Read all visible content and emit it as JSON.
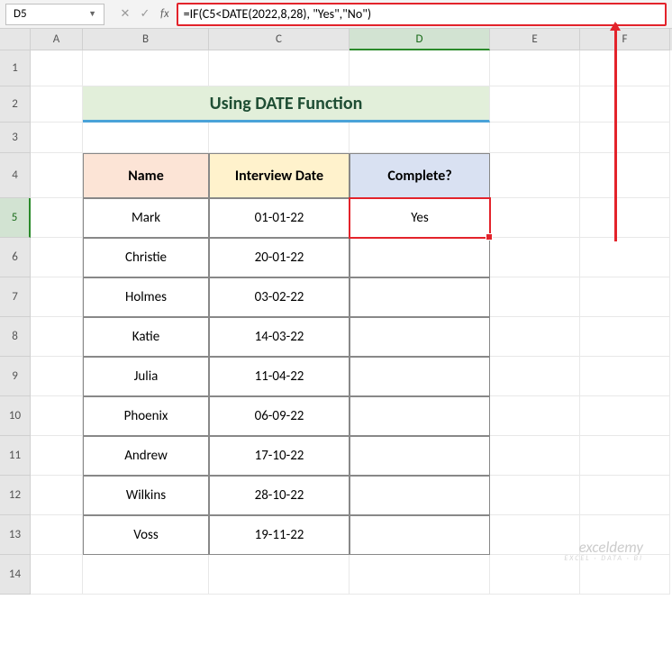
{
  "nameBox": "D5",
  "formula": "=IF(C5<DATE(2022,8,28), \"Yes\",\"No\")",
  "colHeaders": [
    "A",
    "B",
    "C",
    "D",
    "E",
    "F"
  ],
  "rowHeaders": [
    1,
    2,
    3,
    4,
    5,
    6,
    7,
    8,
    9,
    10,
    11,
    12,
    13,
    14
  ],
  "selectedCol": "D",
  "selectedRow": 5,
  "title": "Using DATE Function",
  "tableHeaders": {
    "name": "Name",
    "date": "Interview Date",
    "complete": "Complete?"
  },
  "rows": [
    {
      "name": "Mark",
      "date": "01-01-22",
      "complete": "Yes"
    },
    {
      "name": "Christie",
      "date": "20-01-22",
      "complete": ""
    },
    {
      "name": "Holmes",
      "date": "03-02-22",
      "complete": ""
    },
    {
      "name": "Katie",
      "date": "14-03-22",
      "complete": ""
    },
    {
      "name": "Julia",
      "date": "11-04-22",
      "complete": ""
    },
    {
      "name": "Phoenix",
      "date": "06-09-22",
      "complete": ""
    },
    {
      "name": "Andrew",
      "date": "17-10-22",
      "complete": ""
    },
    {
      "name": "Wilkins",
      "date": "28-10-22",
      "complete": ""
    },
    {
      "name": "Voss",
      "date": "19-11-22",
      "complete": ""
    }
  ],
  "watermark": {
    "main": "exceldemy",
    "sub": "EXCEL · DATA · BI"
  }
}
